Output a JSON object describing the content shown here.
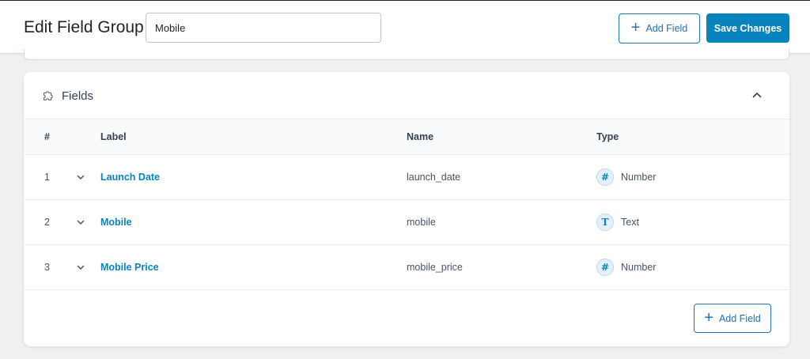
{
  "header": {
    "title": "Edit Field Group",
    "group_name_value": "Mobile",
    "add_field_label": "Add Field",
    "save_label": "Save Changes"
  },
  "fields_panel": {
    "title": "Fields",
    "columns": {
      "number": "#",
      "label": "Label",
      "name": "Name",
      "type": "Type"
    },
    "rows": [
      {
        "number": "1",
        "label": "Launch Date",
        "name": "launch_date",
        "type": "Number",
        "type_icon": "#"
      },
      {
        "number": "2",
        "label": "Mobile",
        "name": "mobile",
        "type": "Text",
        "type_icon": "T"
      },
      {
        "number": "3",
        "label": "Mobile Price",
        "name": "mobile_price",
        "type": "Number",
        "type_icon": "#"
      }
    ],
    "footer_add_field_label": "Add Field"
  },
  "icons": {
    "panel": "puzzle-icon",
    "collapse": "chevron-up-icon",
    "row_toggle": "chevron-down-icon",
    "add": "plus-icon"
  },
  "colors": {
    "primary": "#0783be",
    "outline_button": "#2271b1",
    "notice_border": "#c8e6c9"
  }
}
